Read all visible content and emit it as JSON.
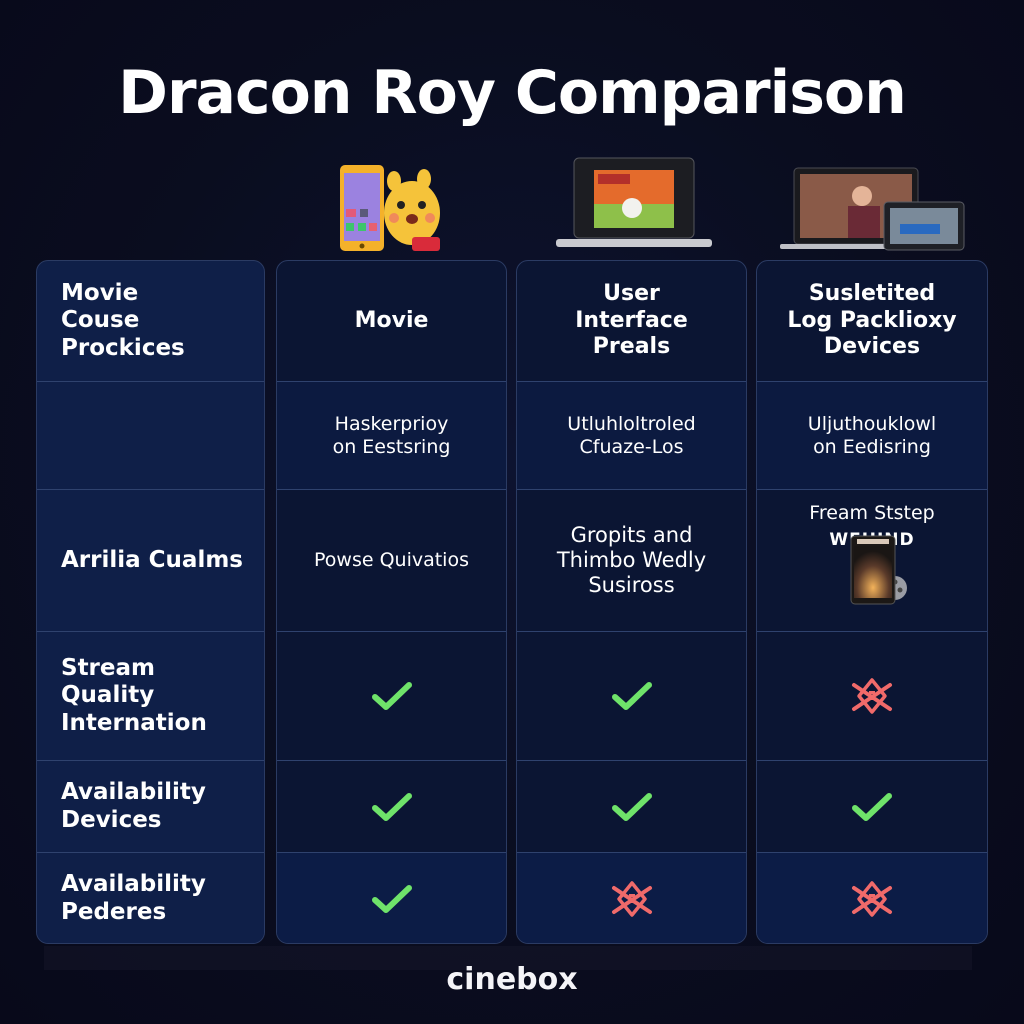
{
  "title": "Dracon Roy Comparison",
  "brand": "cinebox",
  "columns": [
    {
      "header": [
        "Movie",
        "Couse",
        "Prockices"
      ],
      "device_art": "",
      "rows": [
        [
          "Movie",
          "Couse",
          "Prockices"
        ],
        [],
        [
          "Arrilia Cualms"
        ],
        [
          "Stream",
          "Quality",
          "Internation"
        ],
        [
          "Availability",
          "Devices"
        ],
        [
          "Availability",
          "Pederes"
        ]
      ]
    },
    {
      "device_art": "phone-and-mascot-illustration",
      "header": [
        "Movie"
      ],
      "row1": [
        "Haskerprioy",
        "on Eestsring"
      ],
      "row2": [
        "Powse Quivatios"
      ],
      "marks": [
        "check",
        "check",
        "check"
      ]
    },
    {
      "device_art": "laptop-illustration",
      "header": [
        "User",
        "Interface",
        "Preals"
      ],
      "row1": [
        "Utluhloltroled",
        "Cfuaze-Los"
      ],
      "row2": [
        "Gropits and",
        "Thimbo Wedly",
        "Susiross"
      ],
      "marks": [
        "check",
        "check",
        "cross"
      ]
    },
    {
      "device_art": "laptop-and-tablet-illustration",
      "header": [
        "Susletited",
        "Log Packlioxy",
        "Devices"
      ],
      "row1": [
        "Uljuthouklowl",
        "on Eedisring"
      ],
      "row2": [
        "Fream Ststep",
        "WEHIND"
      ],
      "row2_art": "phone-poster-with-film-reel",
      "marks": [
        "cross",
        "check",
        "cross"
      ]
    }
  ],
  "colors": {
    "check": "#6fe36a",
    "cross": "#f06a6a",
    "background": "#0a0d1f",
    "cell": "#0b1533",
    "cell_first": "#0f1f48",
    "border": "#2f426e"
  }
}
